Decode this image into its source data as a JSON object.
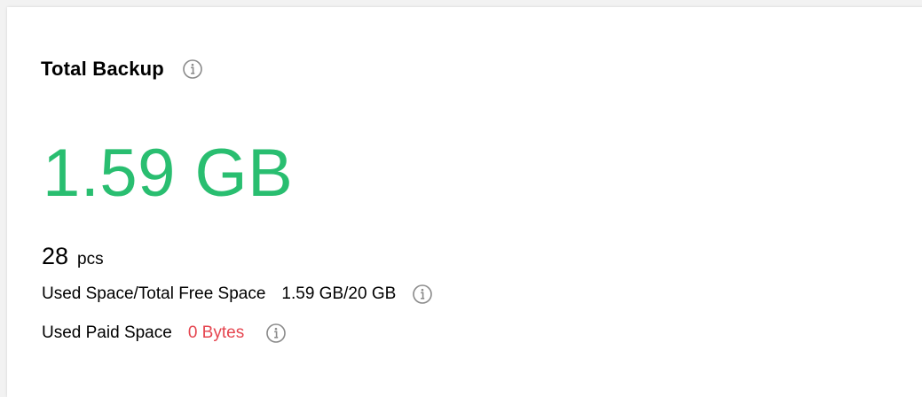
{
  "panel": {
    "title": "Total Backup",
    "total_size": "1.59 GB",
    "count": "28",
    "count_unit": "pcs",
    "used_space_label": "Used Space/Total Free Space",
    "used_space_value": "1.59 GB/20 GB",
    "paid_space_label": "Used Paid Space",
    "paid_space_value": "0 Bytes"
  },
  "icons": {
    "title_info": "info-icon",
    "used_space_info": "info-icon",
    "paid_space_info": "info-icon"
  },
  "colors": {
    "total_size": "#29be70",
    "paid_space_value": "#e5454f"
  }
}
